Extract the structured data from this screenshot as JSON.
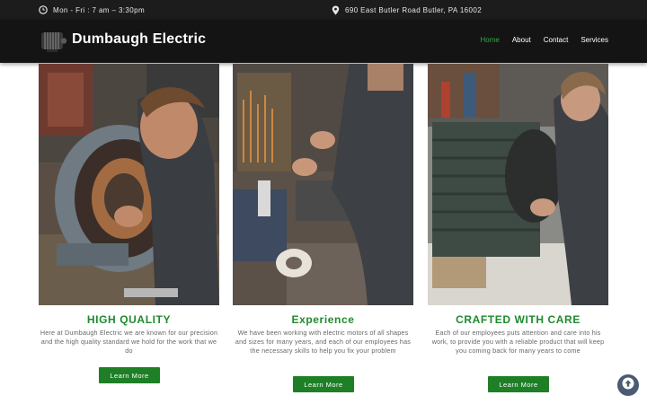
{
  "topbar": {
    "hours": "Mon - Fri : 7 am – 3:30pm",
    "address": "690 East Butler Road Butler, PA 16002"
  },
  "header": {
    "brand": "Dumbaugh Electric",
    "nav": [
      {
        "label": "Home",
        "active": true
      },
      {
        "label": "About",
        "active": false
      },
      {
        "label": "Contact",
        "active": false
      },
      {
        "label": "Services",
        "active": false
      }
    ]
  },
  "features": [
    {
      "title": "HIGH QUALITY",
      "text": "Here at Dumbaugh Electric we are known for our precision and the high quality standard we hold for the work that we do",
      "button": "Learn More"
    },
    {
      "title": "Experience",
      "text": "We have been working with electric motors of all shapes and sizes for many years, and each of our employees has the necessary skills to help you fix your problem",
      "button": "Learn More"
    },
    {
      "title": "CRAFTED WITH CARE",
      "text": "Each of our employees puts attention and care into his work, to provide you with a reliable product that will keep you coming back for many years to come",
      "button": "Learn More"
    }
  ],
  "colors": {
    "accent": "#1f8a2e",
    "button": "#1e7f27",
    "nav_active": "#35a845",
    "header_bg": "#141414",
    "topbar_bg": "#1c1c1c"
  },
  "icons": {
    "hours": "clock-icon",
    "address": "map-pin-icon",
    "scroll": "arrow-up-icon"
  }
}
